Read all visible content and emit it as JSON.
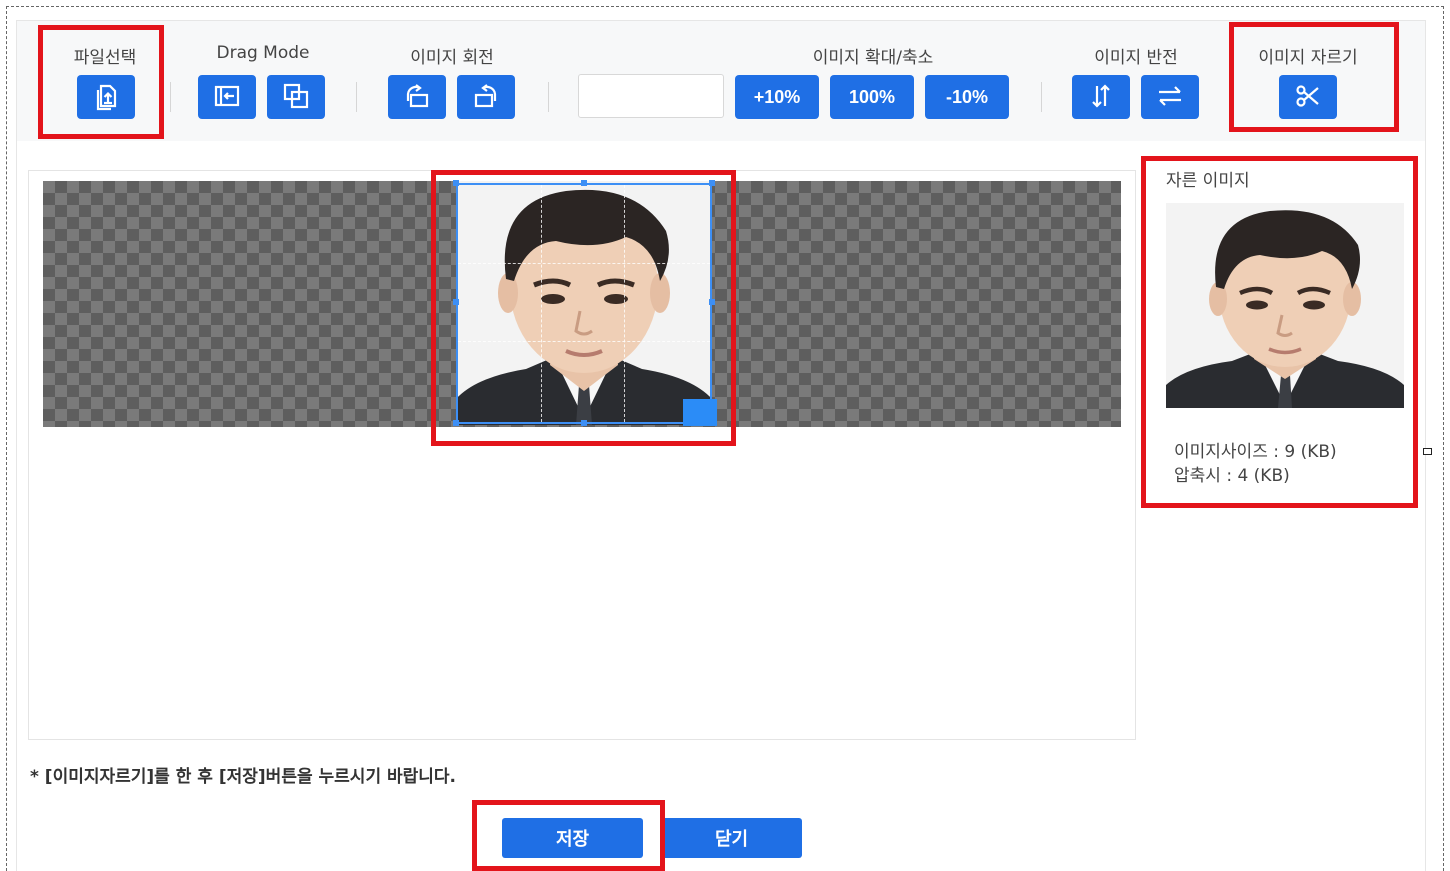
{
  "toolbar": {
    "file_select": {
      "label": "파일선택",
      "icon": "file-upload-icon"
    },
    "drag_mode": {
      "label": "Drag Mode",
      "buttons": [
        {
          "icon": "move-arrow-icon"
        },
        {
          "icon": "crop-select-icon"
        }
      ]
    },
    "rotate": {
      "label": "이미지 회전",
      "buttons": [
        {
          "icon": "rotate-left-icon"
        },
        {
          "icon": "rotate-right-icon"
        }
      ]
    },
    "zoom": {
      "label": "이미지 확대/축소",
      "input_value": "",
      "buttons": [
        "+10%",
        "100%",
        "-10%"
      ]
    },
    "flip": {
      "label": "이미지 반전",
      "buttons": [
        {
          "icon": "flip-vertical-icon"
        },
        {
          "icon": "flip-horizontal-icon"
        }
      ]
    },
    "crop": {
      "label": "이미지 자르기",
      "icon": "scissors-icon"
    }
  },
  "preview": {
    "title": "자른 이미지",
    "size_text": "이미지사이즈 : 9 (KB)",
    "compressed_text": "압축시 : 4 (KB)"
  },
  "notice": "* [이미지자르기]를 한 후 [저장]버튼을 누르시기 바랍니다.",
  "actions": {
    "save": "저장",
    "close": "닫기"
  },
  "colors": {
    "primary": "#1f6fe5",
    "highlight": "#e3141b",
    "crop_border": "#3d8ff5"
  }
}
